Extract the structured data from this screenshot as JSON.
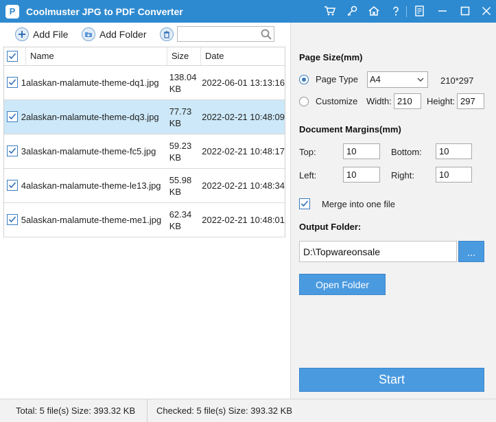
{
  "window": {
    "title": "Coolmuster JPG to PDF Converter",
    "logo_text": "P"
  },
  "toolbar": {
    "add_file_label": "Add File",
    "add_folder_label": "Add Folder",
    "search_value": ""
  },
  "table": {
    "headers": {
      "name": "Name",
      "size": "Size",
      "date": "Date"
    },
    "rows": [
      {
        "name": "1alaskan-malamute-theme-dq1.jpg",
        "size_value": "138.04",
        "size_unit": "KB",
        "date": "2022-06-01 13:13:16",
        "checked": true,
        "selected": false
      },
      {
        "name": "2alaskan-malamute-theme-dq3.jpg",
        "size_value": "77.73",
        "size_unit": "KB",
        "date": "2022-02-21 10:48:09",
        "checked": true,
        "selected": true
      },
      {
        "name": "3alaskan-malamute-theme-fc5.jpg",
        "size_value": "59.23",
        "size_unit": "KB",
        "date": "2022-02-21 10:48:17",
        "checked": true,
        "selected": false
      },
      {
        "name": "4alaskan-malamute-theme-le13.jpg",
        "size_value": "55.98",
        "size_unit": "KB",
        "date": "2022-02-21 10:48:34",
        "checked": true,
        "selected": false
      },
      {
        "name": "5alaskan-malamute-theme-me1.jpg",
        "size_value": "62.34",
        "size_unit": "KB",
        "date": "2022-02-21 10:48:01",
        "checked": true,
        "selected": false
      }
    ]
  },
  "settings": {
    "page_size_title": "Page Size(mm)",
    "page_type_label": "Page Type",
    "page_type_value": "A4",
    "page_type_dims": "210*297",
    "customize_label": "Customize",
    "width_label": "Width:",
    "width_value": "210",
    "height_label": "Height:",
    "height_value": "297",
    "margins_title": "Document Margins(mm)",
    "top_label": "Top:",
    "top_value": "10",
    "bottom_label": "Bottom:",
    "bottom_value": "10",
    "left_label": "Left:",
    "left_value": "10",
    "right_label": "Right:",
    "right_value": "10",
    "merge_label": "Merge into one file",
    "merge_checked": true,
    "output_folder_title": "Output Folder:",
    "output_path": "D:\\Topwareonsale",
    "browse_label": "...",
    "open_folder_label": "Open Folder",
    "start_label": "Start"
  },
  "status": {
    "total": "Total: 5 file(s) Size: 393.32 KB",
    "checked": "Checked: 5 file(s) Size: 393.32 KB"
  },
  "colors": {
    "titlebar": "#2e8ad0",
    "accent": "#4a9ae0",
    "selected_row": "#cde8f8"
  }
}
